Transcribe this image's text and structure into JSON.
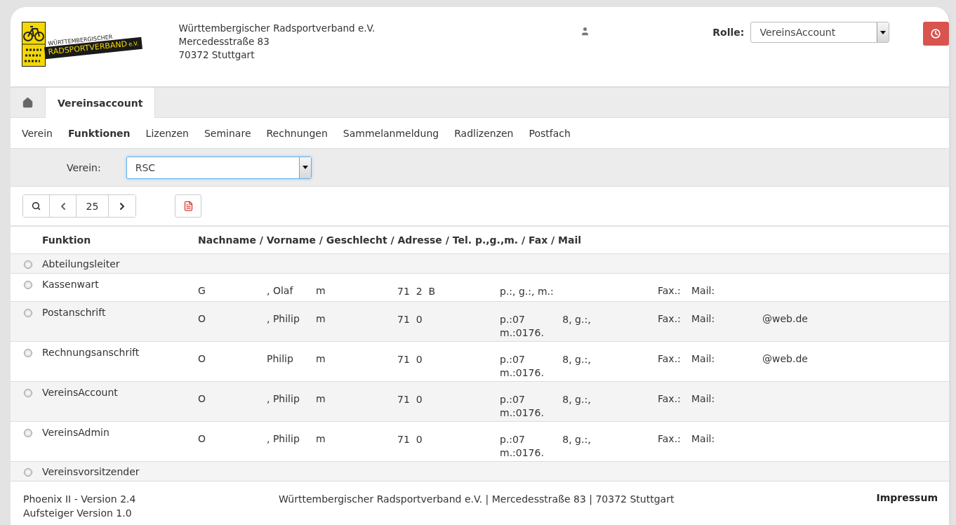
{
  "logo": {
    "top": "WÜRTTEMBERGISCHER",
    "main": "RADSPORTVERBAND",
    "suffix": "e.V."
  },
  "address": [
    "Württembergischer Radsportverband e.V.",
    "Mercedesstraße 83",
    "70372 Stuttgart"
  ],
  "role": {
    "label": "Rolle:",
    "value": "VereinsAccount"
  },
  "tabs": [
    {
      "kind": "home",
      "selected": false
    },
    {
      "kind": "text",
      "label": "Vereinsaccount",
      "selected": true
    }
  ],
  "nav": [
    {
      "label": "Verein",
      "selected": false
    },
    {
      "label": "Funktionen",
      "selected": true
    },
    {
      "label": "Lizenzen",
      "selected": false
    },
    {
      "label": "Seminare",
      "selected": false
    },
    {
      "label": "Rechnungen",
      "selected": false
    },
    {
      "label": "Sammelanmeldung",
      "selected": false
    },
    {
      "label": "Radlizenzen",
      "selected": false
    },
    {
      "label": "Postfach",
      "selected": false
    }
  ],
  "filter": {
    "label": "Verein:",
    "value": "RSC"
  },
  "pager": {
    "page_size": "25"
  },
  "table": {
    "columns": [
      "Funktion",
      "Nachname / Vorname / Geschlecht / Adresse / Tel. p.,g.,m. / Fax / Mail"
    ],
    "rows": [
      {
        "funktion": "Abteilungsleiter",
        "selected": false
      },
      {
        "funktion": "Kassenwart",
        "selected": false,
        "nachname": "G",
        "vorname": ", Olaf",
        "geschlecht": "m",
        "adresse": "71  2  B",
        "tel": [
          "p.:, g.:, m.:"
        ],
        "fax": "Fax.:",
        "mail": "Mail:"
      },
      {
        "funktion": "Postanschrift",
        "selected": false,
        "nachname": "O",
        "vorname": ", Philip",
        "geschlecht": "m",
        "adresse": "71  0",
        "tel": [
          "p.:07            8, g.:,",
          "m.:0176."
        ],
        "fax": "Fax.:",
        "mail": "Mail:",
        "mail_value": "@web.de"
      },
      {
        "funktion": "Rechnungsanschrift",
        "selected": false,
        "nachname": "O",
        "vorname": "Philip",
        "geschlecht": "m",
        "adresse": "71  0",
        "tel": [
          "p.:07            8, g.:,",
          "m.:0176."
        ],
        "fax": "Fax.:",
        "mail": "Mail:",
        "mail_value": "@web.de"
      },
      {
        "funktion": "VereinsAccount",
        "selected": false,
        "nachname": "O",
        "vorname": ", Philip",
        "geschlecht": "m",
        "adresse": "71  0",
        "tel": [
          "p.:07            8, g.:,",
          "m.:0176."
        ],
        "fax": "Fax.:",
        "mail": "Mail:"
      },
      {
        "funktion": "VereinsAdmin",
        "selected": false,
        "nachname": "O",
        "vorname": ", Philip",
        "geschlecht": "m",
        "adresse": "71  0",
        "tel": [
          "p.:07            8, g.:,",
          "m.:0176."
        ],
        "fax": "Fax.:",
        "mail": "Mail:"
      },
      {
        "funktion": "Vereinsvorsitzender",
        "selected": false
      }
    ]
  },
  "footer": {
    "version": [
      "Phoenix II - Version 2.4",
      "Aufsteiger Version 1.0"
    ],
    "center": "Württembergischer Radsportverband e.V. | Mercedesstraße 83 | 70372 Stuttgart",
    "link": "Impressum"
  }
}
